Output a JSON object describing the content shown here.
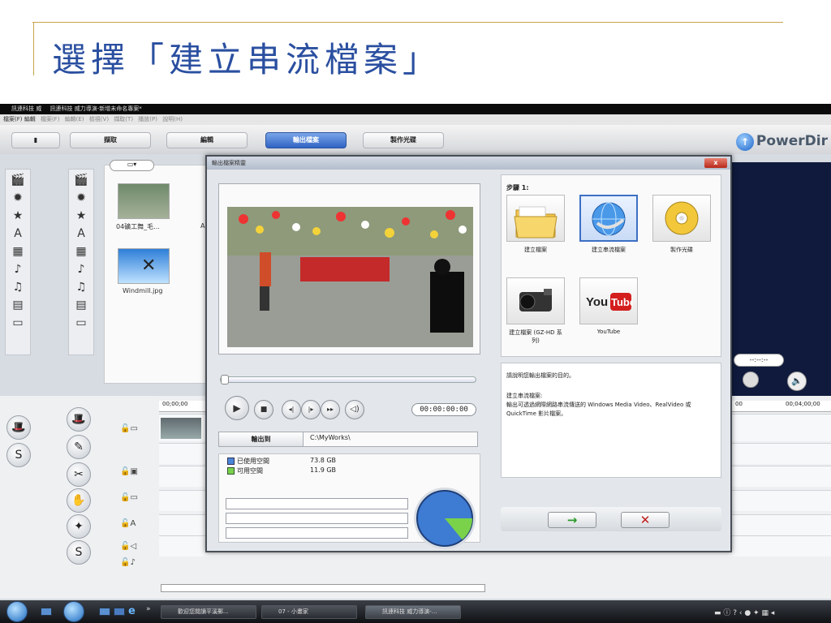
{
  "slide": {
    "title": "選擇「建立串流檔案」"
  },
  "app": {
    "window_title": "訊連科技 威力導演-新增未命名專案*",
    "window_title_short": "訊連科技 威",
    "menu": [
      "檔案(F)",
      "編輯(E)",
      "檢視(V)",
      "擷取(T)",
      "播放(P)",
      "說明(H)"
    ],
    "menu_short": "檔案(F)  編輯",
    "tabs": [
      {
        "label": "擷取"
      },
      {
        "label": "編輯"
      },
      {
        "label": "輸出檔案"
      },
      {
        "label": "製作光碟"
      }
    ],
    "brand": "PowerDir",
    "active_tab": "輸出檔案"
  },
  "library": {
    "items": [
      {
        "label": "04礦工舞_毛..."
      },
      {
        "label": "Windmill.jpg"
      }
    ],
    "partial_label": "A"
  },
  "right_panel": {
    "timecode": "--:--:--",
    "ruler_left": "00",
    "ruler_right": "00;04;00;00"
  },
  "timeline": {
    "start": "00;00;00",
    "left_timecode": "00;00;00"
  },
  "dialog": {
    "title": "輸出檔案精靈",
    "close": "x",
    "timecode": "00:00:00:00",
    "output_to": {
      "label": "輸出到",
      "path": "C:\\MyWorks\\"
    },
    "disk": [
      {
        "label": "已使用空間",
        "value": "73.8 GB",
        "color": "#4a86d8"
      },
      {
        "label": "可用空間",
        "value": "11.9 GB",
        "color": "#7ad24a"
      }
    ],
    "pie": {
      "used_percent": 86,
      "free_percent": 14
    },
    "step_title": "步驟 1:",
    "options": [
      {
        "label": "建立檔案",
        "icon": "folder-icon",
        "selected": false
      },
      {
        "label": "建立串流檔案",
        "icon": "globe-icon",
        "selected": true
      },
      {
        "label": "製作光碟",
        "icon": "disc-icon",
        "selected": false
      },
      {
        "label": "建立檔案 (GZ-HD 系列)",
        "icon": "camcorder-icon",
        "selected": false
      },
      {
        "label": "YouTube",
        "icon": "youtube-icon",
        "selected": false
      }
    ],
    "description_prompt": "請說明您輸出檔案的目的。",
    "description_title": "建立串流檔案:",
    "description_body": "輸出可透過網際網路串流傳送的 Windows Media Video、RealVideo 或 QuickTime 影片檔案。",
    "next": "→",
    "cancel": "✕"
  },
  "taskbar": {
    "items": [
      {
        "label": "歡迎您閱讀平溪郵..."
      },
      {
        "label": "07 - 小畫家"
      },
      {
        "label": "訊連科技 威力導演-..."
      }
    ]
  }
}
